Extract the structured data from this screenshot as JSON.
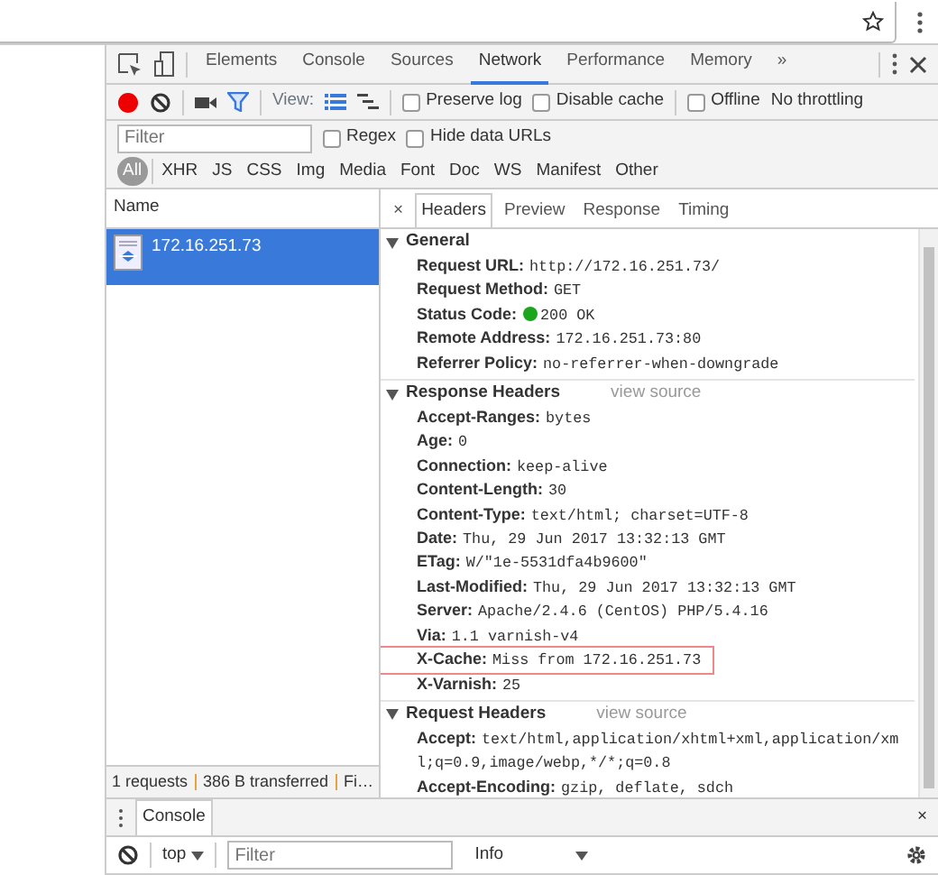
{
  "devtools": {
    "tabs": [
      {
        "label": "Elements",
        "selected": false
      },
      {
        "label": "Console",
        "selected": false
      },
      {
        "label": "Sources",
        "selected": false
      },
      {
        "label": "Network",
        "selected": true
      },
      {
        "label": "Performance",
        "selected": false
      },
      {
        "label": "Memory",
        "selected": false
      }
    ],
    "more_tabs": "»"
  },
  "toolbar": {
    "recording": true,
    "filter_on": true,
    "view_label": "View:",
    "views": [
      {
        "kind": "list",
        "selected": true
      },
      {
        "kind": "waterfall",
        "selected": false
      }
    ],
    "checkboxes": [
      {
        "label": "Preserve log",
        "checked": false
      },
      {
        "label": "Disable cache",
        "checked": false
      },
      {
        "label": "Offline",
        "checked": false
      }
    ],
    "throttling": "No throttling"
  },
  "filter_bar": {
    "placeholder": "Filter",
    "checkboxes": [
      {
        "label": "Regex",
        "checked": false
      },
      {
        "label": "Hide data URLs",
        "checked": false
      }
    ]
  },
  "types": [
    {
      "label": "All",
      "selected": true
    },
    {
      "label": "XHR",
      "selected": false
    },
    {
      "label": "JS",
      "selected": false
    },
    {
      "label": "CSS",
      "selected": false
    },
    {
      "label": "Img",
      "selected": false
    },
    {
      "label": "Media",
      "selected": false
    },
    {
      "label": "Font",
      "selected": false
    },
    {
      "label": "Doc",
      "selected": false
    },
    {
      "label": "WS",
      "selected": false
    },
    {
      "label": "Manifest",
      "selected": false
    },
    {
      "label": "Other",
      "selected": false
    }
  ],
  "requests": {
    "column": "Name",
    "rows": [
      {
        "name": "172.16.251.73",
        "selected": true
      }
    ],
    "status_bar": [
      "1 requests",
      "386 B transferred",
      "Fi…"
    ]
  },
  "details": {
    "close": "×",
    "tabs": [
      {
        "label": "Headers",
        "selected": true
      },
      {
        "label": "Preview",
        "selected": false
      },
      {
        "label": "Response",
        "selected": false
      },
      {
        "label": "Timing",
        "selected": false
      }
    ],
    "sections": [
      {
        "title": "General",
        "expanded": true,
        "headers": [
          {
            "name": "Request URL:",
            "value": "http://172.16.251.73/",
            "highlighted": false
          },
          {
            "name": "Request Method:",
            "value": "GET",
            "highlighted": false
          },
          {
            "name": "Status Code:",
            "value": "200 OK",
            "color": "#1da51d",
            "highlighted": false
          },
          {
            "name": "Remote Address:",
            "value": "172.16.251.73:80",
            "highlighted": false
          },
          {
            "name": "Referrer Policy:",
            "value": "no-referrer-when-downgrade",
            "highlighted": false
          }
        ]
      },
      {
        "title": "Response Headers",
        "expanded": true,
        "link": "view source",
        "headers": [
          {
            "name": "Accept-Ranges:",
            "value": "bytes",
            "highlighted": false
          },
          {
            "name": "Age:",
            "value": "0",
            "highlighted": false
          },
          {
            "name": "Connection:",
            "value": "keep-alive",
            "highlighted": false
          },
          {
            "name": "Content-Length:",
            "value": "30",
            "highlighted": false
          },
          {
            "name": "Content-Type:",
            "value": "text/html; charset=UTF-8",
            "highlighted": false
          },
          {
            "name": "Date:",
            "value": "Thu, 29 Jun 2017 13:32:13 GMT",
            "highlighted": false
          },
          {
            "name": "ETag:",
            "value": "W/\"1e-5531dfa4b9600\"",
            "highlighted": false
          },
          {
            "name": "Last-Modified:",
            "value": "Thu, 29 Jun 2017 13:32:13 GMT",
            "highlighted": false
          },
          {
            "name": "Server:",
            "value": "Apache/2.4.6 (CentOS) PHP/5.4.16",
            "highlighted": false
          },
          {
            "name": "Via:",
            "value": "1.1 varnish-v4",
            "highlighted": false
          },
          {
            "name": "X-Cache:",
            "value": "Miss from 172.16.251.73",
            "highlighted": true
          },
          {
            "name": "X-Varnish:",
            "value": "25",
            "highlighted": false
          }
        ]
      },
      {
        "title": "Request Headers",
        "expanded": true,
        "link": "view source",
        "headers": [
          {
            "name": "Accept:",
            "value": "text/html,application/xhtml+xml,application/xml;q=0.9,image/webp,*/*;q=0.8",
            "highlighted": false
          },
          {
            "name": "Accept-Encoding:",
            "value": "gzip, deflate, sdch",
            "highlighted": false
          }
        ]
      }
    ]
  },
  "drawer": {
    "tabs": [
      {
        "label": "Console",
        "selected": true
      }
    ],
    "close": "×",
    "context": "top",
    "filter_placeholder": "Filter",
    "level": "Info"
  }
}
